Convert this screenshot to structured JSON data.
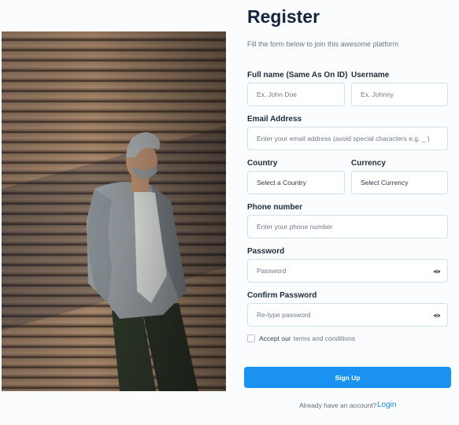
{
  "form": {
    "title": "Register",
    "subtitle": "Fill the form below to join this awesome platform",
    "fullname": {
      "label": "Full name (Same As On ID)",
      "placeholder": "Ex. John Doe"
    },
    "username": {
      "label": "Username",
      "placeholder": "Ex. Johnny"
    },
    "email": {
      "label": "Email Address",
      "placeholder": "Enter your email address (avoid special characters e.g. _ )"
    },
    "country": {
      "label": "Country",
      "value": "Select a Country"
    },
    "currency": {
      "label": "Currency",
      "value": "Select Currency"
    },
    "phone": {
      "label": "Phone number",
      "placeholder": "Enter your phone number"
    },
    "password": {
      "label": "Password",
      "placeholder": "Password",
      "toggle_icon": "eye-icon"
    },
    "confirm": {
      "label": "Confirm Password",
      "placeholder": "Re-type password",
      "toggle_icon": "eye-icon"
    },
    "terms": {
      "prefix": "Accept our",
      "link": "terms and conditions"
    },
    "submit": "Sign Up",
    "footer": {
      "text": "Already have an account?",
      "link": "Login"
    }
  },
  "colors": {
    "accent": "#1a92f2",
    "title": "#14243a",
    "field_border": "#cfe0ee"
  }
}
